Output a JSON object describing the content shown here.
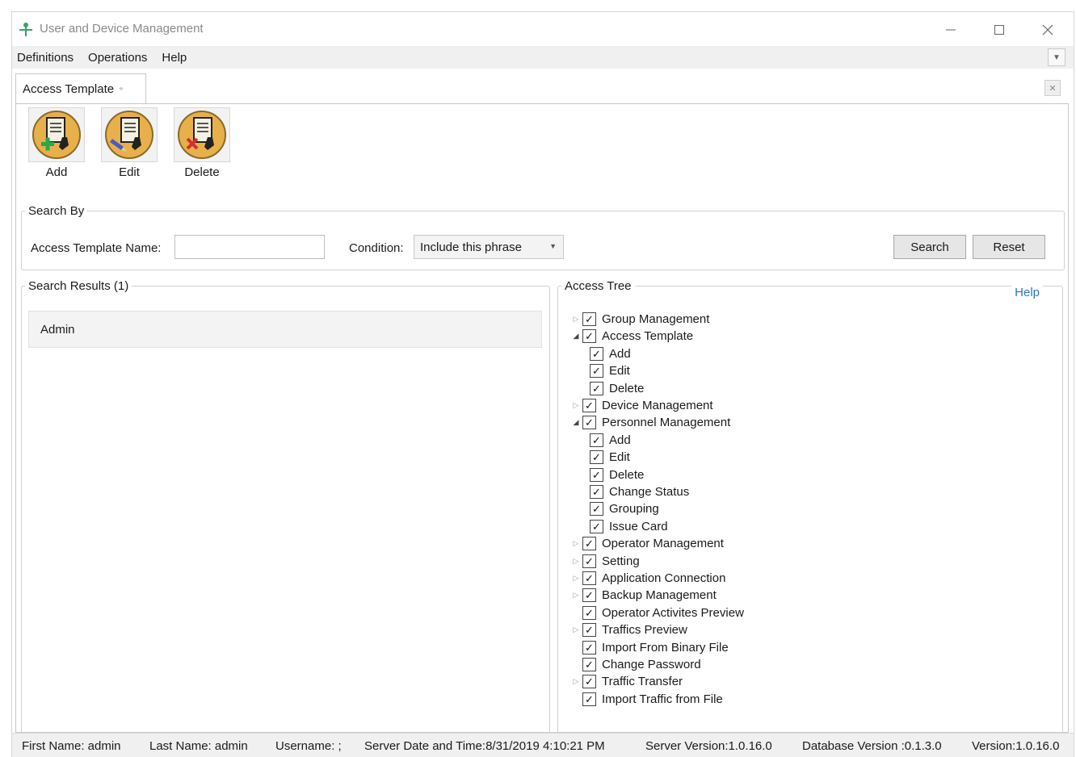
{
  "window": {
    "title": "User and Device Management"
  },
  "menu": [
    "Definitions",
    "Operations",
    "Help"
  ],
  "tab": {
    "label": "Access Template"
  },
  "toolbar": {
    "add_label": "Add",
    "edit_label": "Edit",
    "delete_label": "Delete"
  },
  "search_by": {
    "legend": "Search By",
    "name_label": "Access Template Name:",
    "name_value": "",
    "condition_label": "Condition:",
    "condition_value": "Include this phrase",
    "search_label": "Search",
    "reset_label": "Reset"
  },
  "results": {
    "legend": "Search Results (1)",
    "items": [
      "Admin"
    ]
  },
  "access_tree": {
    "legend": "Access Tree",
    "help_label": "Help",
    "nodes": [
      {
        "label": "Group Management",
        "checked": true,
        "level": 0,
        "expander": "collapsed"
      },
      {
        "label": "Access Template",
        "checked": true,
        "level": 0,
        "expander": "expanded"
      },
      {
        "label": "Add",
        "checked": true,
        "level": 1,
        "expander": "none"
      },
      {
        "label": "Edit",
        "checked": true,
        "level": 1,
        "expander": "none"
      },
      {
        "label": "Delete",
        "checked": true,
        "level": 1,
        "expander": "none"
      },
      {
        "label": "Device Management",
        "checked": true,
        "level": 0,
        "expander": "collapsed"
      },
      {
        "label": "Personnel Management",
        "checked": true,
        "level": 0,
        "expander": "expanded"
      },
      {
        "label": "Add",
        "checked": true,
        "level": 1,
        "expander": "none"
      },
      {
        "label": "Edit",
        "checked": true,
        "level": 1,
        "expander": "none"
      },
      {
        "label": "Delete",
        "checked": true,
        "level": 1,
        "expander": "none"
      },
      {
        "label": "Change Status",
        "checked": true,
        "level": 1,
        "expander": "none"
      },
      {
        "label": "Grouping",
        "checked": true,
        "level": 1,
        "expander": "none"
      },
      {
        "label": "Issue Card",
        "checked": true,
        "level": 1,
        "expander": "none"
      },
      {
        "label": "Operator Management",
        "checked": true,
        "level": 0,
        "expander": "collapsed"
      },
      {
        "label": "Setting",
        "checked": true,
        "level": 0,
        "expander": "collapsed"
      },
      {
        "label": "Application Connection",
        "checked": true,
        "level": 0,
        "expander": "collapsed"
      },
      {
        "label": "Backup Management",
        "checked": true,
        "level": 0,
        "expander": "collapsed"
      },
      {
        "label": "Operator Activites Preview",
        "checked": true,
        "level": 0,
        "expander": "none"
      },
      {
        "label": "Traffics Preview",
        "checked": true,
        "level": 0,
        "expander": "collapsed"
      },
      {
        "label": "Import From Binary File",
        "checked": true,
        "level": 0,
        "expander": "none"
      },
      {
        "label": "Change Password",
        "checked": true,
        "level": 0,
        "expander": "none"
      },
      {
        "label": "Traffic Transfer",
        "checked": true,
        "level": 0,
        "expander": "collapsed"
      },
      {
        "label": "Import Traffic from File",
        "checked": true,
        "level": 0,
        "expander": "none"
      }
    ]
  },
  "status": {
    "first_name": "First Name: admin",
    "last_name": "Last Name: admin",
    "username": "Username: ;",
    "server_time": "Server Date and Time:8/31/2019 4:10:21 PM",
    "server_version": "Server Version:1.0.16.0",
    "db_version": "Database Version :0.1.3.0",
    "version": "Version:1.0.16.0"
  },
  "colors": {
    "link": "#2e74c8",
    "icon_gold": "#e8b04a",
    "add_green": "#2aa84a",
    "delete_red": "#d23030"
  }
}
